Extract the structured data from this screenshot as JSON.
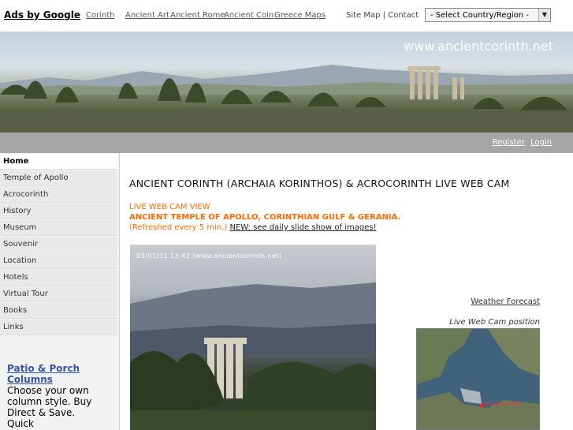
{
  "topbar": {
    "ads_label": "Ads by Google",
    "ad_links": [
      "Corinth",
      "Ancient Art",
      "Ancient Rome",
      "Ancient Coin",
      "Greece Maps"
    ],
    "sitemap": "Site Map",
    "separator": "|",
    "contact": "Contact",
    "country_select": "- Select Country/Region -"
  },
  "banner": {
    "site_url": "www.ancientcorinth.net"
  },
  "auth": {
    "register": "Register",
    "login": "Login"
  },
  "sidebar": {
    "items": [
      {
        "label": "Home",
        "active": true
      },
      {
        "label": "Temple of Apollo"
      },
      {
        "label": "Acrocorinth"
      },
      {
        "label": "History"
      },
      {
        "label": "Museum"
      },
      {
        "label": "Souvenir"
      },
      {
        "label": "Location"
      },
      {
        "label": "Hotels"
      },
      {
        "label": "Virtual Tour"
      },
      {
        "label": "Books"
      },
      {
        "label": "Links"
      }
    ],
    "ad": {
      "title_line1": "Patio & Porch",
      "title_line2": "Columns",
      "body": "Choose your own column style. Buy Direct & Save. Quick"
    }
  },
  "main": {
    "title": "ANCIENT CORINTH (ARCHAIA KORINTHOS) & ACROCORINTH LIVE WEB CAM",
    "live_label": "LIVE WEB CAM VIEW",
    "subtitle": "ANCIENT TEMPLE OF APOLLO, CORINTHIAN GULF & GERANIA.",
    "refresh": "(Refreshed every 5 min.)",
    "slideshow": "NEW: see daily slide show of images!",
    "cam_stamp": "03/01/11 13:42 (www.ancientcorinth.net)",
    "weather": "Weather Forecast",
    "cam_position": "Live Web Cam position",
    "map_label": "Ancient Corinth"
  }
}
